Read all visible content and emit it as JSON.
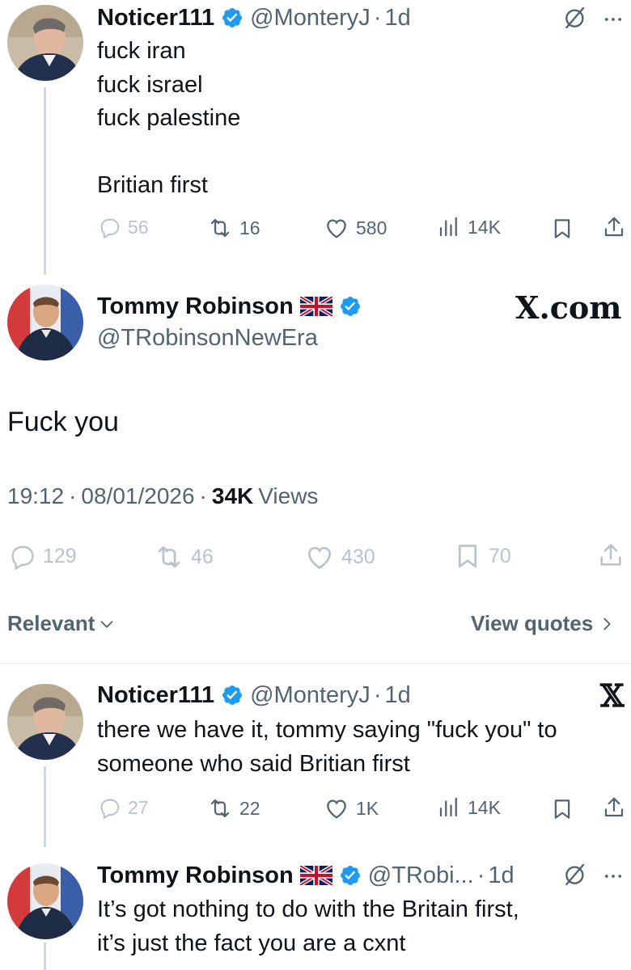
{
  "tweet1": {
    "name": "Noticer111",
    "handle": "@MonteryJ",
    "sep": "·",
    "time": "1d",
    "lines": [
      "fuck iran",
      "fuck israel",
      "fuck palestine",
      "",
      "Britian first"
    ],
    "replies": "56",
    "reposts": "16",
    "likes": "580",
    "views": "14K"
  },
  "main_tweet": {
    "name": "Tommy Robinson",
    "flag": "🇬🇧",
    "handle": "@TRobinsonNewEra",
    "watermark": "X.com",
    "text": "Fuck you",
    "time": "19:12",
    "date": "08/01/2026",
    "views_count": "34K",
    "views_label": "Views",
    "replies": "129",
    "reposts": "46",
    "likes": "430",
    "bookmarks": "70"
  },
  "sort": {
    "relevant_label": "Relevant",
    "view_quotes_label": "View quotes"
  },
  "tweet3": {
    "name": "Noticer111",
    "handle": "@MonteryJ",
    "time": "1d",
    "lines": [
      "there we have it, tommy saying \"fuck you\" to",
      "someone who said Britian first"
    ],
    "replies": "27",
    "reposts": "22",
    "likes": "1K",
    "views": "14K"
  },
  "tweet4": {
    "name": "Tommy Robinson",
    "handle": "@TRobi...",
    "time": "1d",
    "lines": [
      "It’s got nothing to do with the Britain first,",
      "it’s just the fact you are a cxnt"
    ]
  },
  "colors": {
    "text": "#0f1419",
    "secondary": "#536471",
    "verified": "#1d9bf0",
    "faint": "#b8c3cb"
  }
}
